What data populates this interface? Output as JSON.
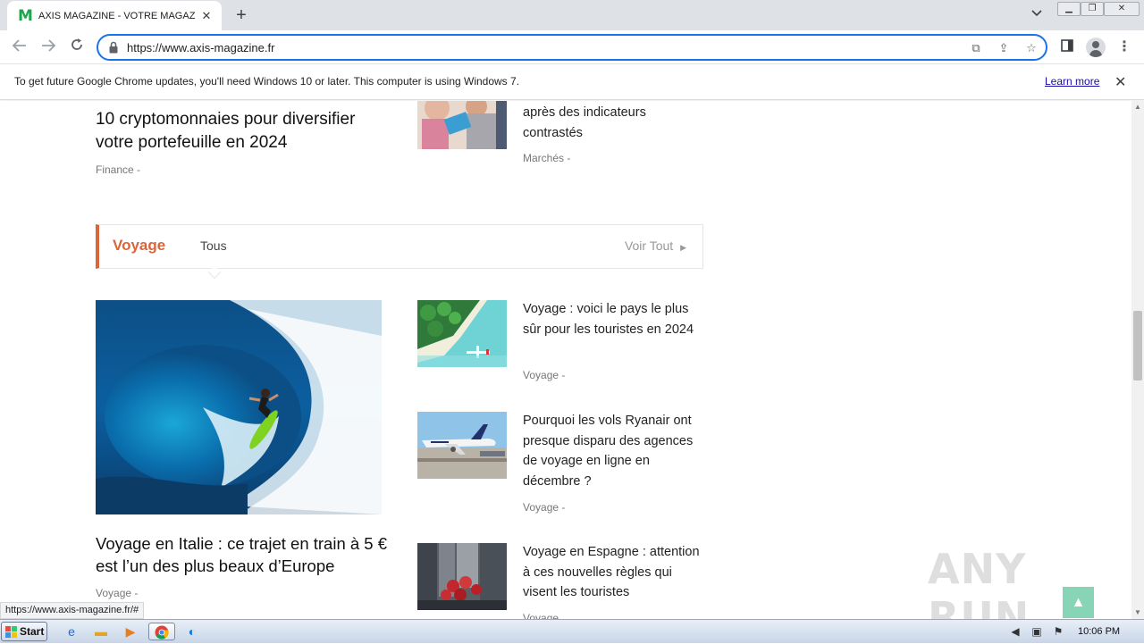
{
  "browser": {
    "tab_title": "AXIS MAGAZINE - VOTRE MAGAZINE",
    "tab_favicon": "M",
    "url": "https://www.axis-magazine.fr",
    "status_url": "https://www.axis-magazine.fr/#"
  },
  "infobar": {
    "message": "To get future Google Chrome updates, you'll need Windows 10 or later. This computer is using Windows 7.",
    "link": "Learn more"
  },
  "top_articles": {
    "left_title": "10 cryptomonnaies pour diversifier votre portefeuille en 2024",
    "left_category": "Finance",
    "right_title": "après des indicateurs contrastés",
    "right_category": "Marchés"
  },
  "section": {
    "title": "Voyage",
    "tab": "Tous",
    "more": "Voir Tout"
  },
  "main_article": {
    "title": "Voyage en Italie : ce trajet en train à 5 € est l’un des plus beaux d’Europe",
    "category": "Voyage"
  },
  "side_articles": [
    {
      "title": "Voyage : voici le pays le plus sûr pour les touristes en 2024",
      "category": "Voyage"
    },
    {
      "title": "Pourquoi les vols Ryanair ont presque disparu des agences de voyage en ligne en décembre ?",
      "category": "Voyage"
    },
    {
      "title": "Voyage en Espagne : attention à ces nouvelles règles qui visent les touristes",
      "category": "Voyage"
    }
  ],
  "meta_separator": "-",
  "watermark": "ANY RUN",
  "taskbar": {
    "start_label": "Start",
    "clock": "10:06 PM"
  },
  "colors": {
    "accent": "#d9663b",
    "backtop": "#88d4b7",
    "omnibox_border": "#1a73e8"
  }
}
